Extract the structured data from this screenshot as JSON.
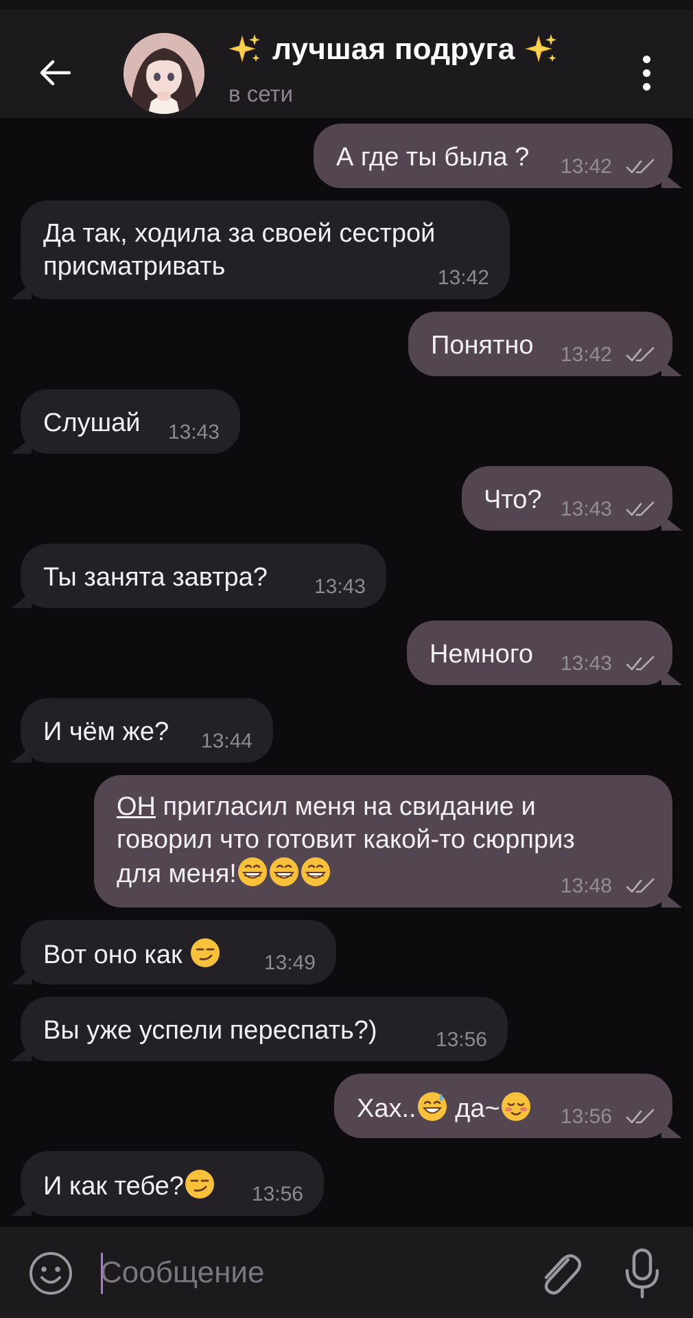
{
  "header": {
    "title": "лучшая подруга",
    "status": "в сети"
  },
  "messages": [
    {
      "dir": "out",
      "text": "А где ты была ?",
      "time": "13:42"
    },
    {
      "dir": "in",
      "line1": "Да так, ходила за своей сестрой",
      "line2": "присматривать",
      "time": "13:42"
    },
    {
      "dir": "out",
      "text": "Понятно",
      "time": "13:42"
    },
    {
      "dir": "in",
      "text": "Слушай",
      "time": "13:43"
    },
    {
      "dir": "out",
      "text": "Что?",
      "time": "13:43"
    },
    {
      "dir": "in",
      "text": "Ты занята завтра?",
      "time": "13:43"
    },
    {
      "dir": "out",
      "text": "Немного",
      "time": "13:43"
    },
    {
      "dir": "in",
      "text": "И чём же?",
      "time": "13:44"
    },
    {
      "dir": "out",
      "emph": "ОН",
      "line1": " пригласил меня на свидание и",
      "line2": "говорил что готовит какой-то сюрприз",
      "line3": "для меня!",
      "time": "13:48"
    },
    {
      "dir": "in",
      "text": "Вот оно как ",
      "time": "13:49"
    },
    {
      "dir": "in",
      "text": "Вы уже успели переспать?)",
      "time": "13:56"
    },
    {
      "dir": "out",
      "text": "Хах..",
      "text2": " да~",
      "time": "13:56"
    },
    {
      "dir": "in",
      "text": "И как тебе?",
      "time": "13:56"
    }
  ],
  "composer": {
    "placeholder": "Сообщение"
  },
  "colors": {
    "background": "#0d0b0d",
    "header": "#1c1a1d",
    "bubble_in": "#232125",
    "bubble_out": "#544650",
    "timestamp": "#948c96"
  },
  "icons": [
    "back-arrow-icon",
    "sparkles-icon",
    "more-vertical-icon",
    "double-check-icon",
    "emoji-icon",
    "attach-icon",
    "microphone-icon",
    "grin-emoji",
    "smirk-emoji",
    "sweat-smile-emoji",
    "blush-emoji"
  ]
}
